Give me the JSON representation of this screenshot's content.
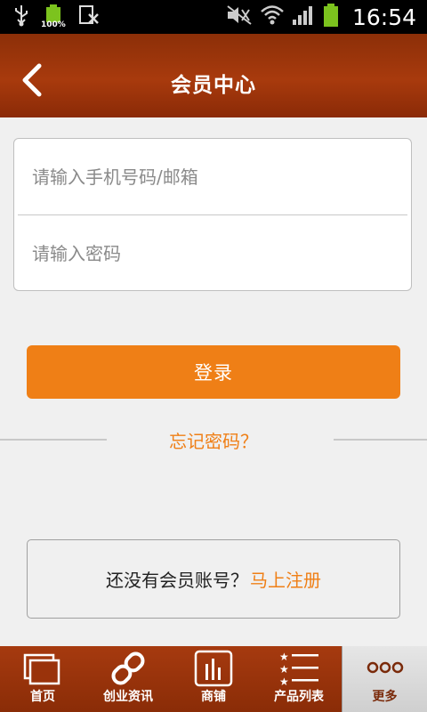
{
  "status_bar": {
    "time": "16:54",
    "battery_percent_label": "100%"
  },
  "header": {
    "title": "会员中心"
  },
  "login_form": {
    "phone_placeholder": "请输入手机号码/邮箱",
    "password_placeholder": "请输入密码",
    "submit_label": "登录",
    "forgot_label": "忘记密码？"
  },
  "register": {
    "prompt": "还没有会员账号？",
    "link": "马上注册"
  },
  "tabbar": {
    "items": [
      {
        "label": "首页",
        "icon": "home-windows-icon"
      },
      {
        "label": "创业资讯",
        "icon": "link-chain-icon"
      },
      {
        "label": "商铺",
        "icon": "shop-bars-icon"
      },
      {
        "label": "产品列表",
        "icon": "star-list-icon"
      },
      {
        "label": "更多",
        "icon": "more-dots-icon"
      }
    ],
    "active_index": 4
  },
  "colors": {
    "accent": "#ef7f16",
    "header": "#9e360c",
    "background": "#f0f0f0"
  }
}
